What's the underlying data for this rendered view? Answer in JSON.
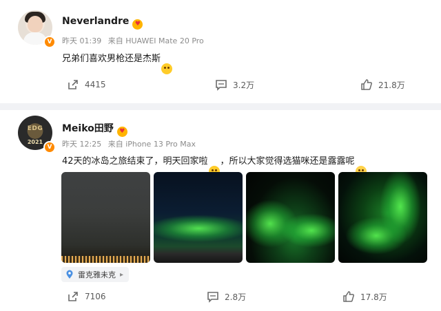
{
  "posts": [
    {
      "username": "Neverlandre",
      "time": "昨天 01:39",
      "source": "来自 HUAWEI Mate 20 Pro",
      "text": "兄弟们喜欢男枪还是杰斯",
      "shares": "4415",
      "comments": "3.2万",
      "likes": "21.8万",
      "icons": {
        "verified": "verified-v-icon",
        "badge": "crown-badge-icon",
        "emoji": "grin-emoji-icon"
      }
    },
    {
      "username": "Meiko田野",
      "time": "昨天 12:25",
      "source": "来自 iPhone 13 Pro Max",
      "text_part1": "42天的冰岛之旅结束了，明天回家啦",
      "text_part2": "，所以大家觉得选猫咪还是露露呢",
      "avatar_logo": "EDG",
      "avatar_year": "2021",
      "location": "雷克雅未克",
      "shares": "7106",
      "comments": "2.8万",
      "likes": "17.8万",
      "photos": [
        "aurora-photo-1",
        "aurora-photo-2",
        "aurora-photo-3",
        "aurora-photo-4"
      ],
      "icons": {
        "verified": "verified-v-icon",
        "badge": "crown-badge-icon",
        "emoji1": "love-emoji-icon",
        "emoji2": "sweat-emoji-icon",
        "location": "map-pin-icon"
      }
    }
  ],
  "colors": {
    "verified": "#ff8a00",
    "separator": "#f1f2f5",
    "meta_text": "#8b8b8b",
    "action_text": "#5a5a5a"
  }
}
